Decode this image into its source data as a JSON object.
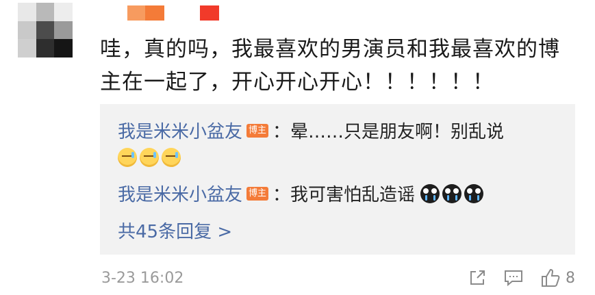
{
  "comment": {
    "text": "哇，真的吗，我最喜欢的男演员和我最喜欢的博主在一起了，开心开心开心！！！！！！",
    "timestamp": "3-23 16:02",
    "like_count": "8"
  },
  "replies": [
    {
      "user": "我是米米小盆友",
      "badge": "博主",
      "text": "：晕……只是朋友啊！别乱说",
      "emoji": "sweat-emoji"
    },
    {
      "user": "我是米米小盆友",
      "badge": "博主",
      "text": "：我可害怕乱造谣",
      "emoji": "cry-emoji"
    }
  ],
  "more_replies_label": "共45条回复 >",
  "colors": {
    "link": "#4a6aa5",
    "badge": "#f47b38",
    "reply_bg": "#f2f2f2"
  },
  "icons": [
    "share-icon",
    "comment-icon",
    "like-icon"
  ]
}
